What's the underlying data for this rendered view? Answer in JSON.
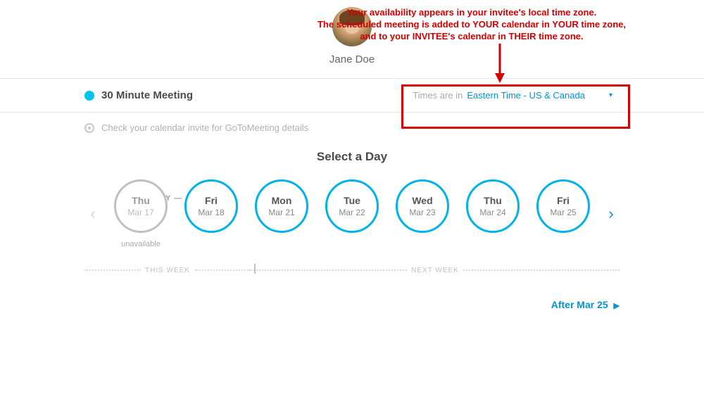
{
  "annotation": {
    "line1": "Your availability appears in your invitee's local time zone.",
    "line2": "The scheduled meeting is added to YOUR calendar in YOUR time zone,",
    "line3": "and to your INVITEE's calendar in THEIR time zone."
  },
  "host": {
    "name": "Jane Doe"
  },
  "meeting": {
    "title": "30 Minute Meeting",
    "gotomeeting_note": "Check your calendar invite for GoToMeeting details"
  },
  "timezone": {
    "label": "Times are in",
    "value": "Eastern Time - US & Canada"
  },
  "select_day_title": "Select a Day",
  "today_marker": "— TODAY —",
  "days": [
    {
      "dow": "Thu",
      "date": "Mar 17",
      "unavailable": true,
      "sub": "unavailable"
    },
    {
      "dow": "Fri",
      "date": "Mar 18",
      "unavailable": false,
      "sub": ""
    },
    {
      "dow": "Mon",
      "date": "Mar 21",
      "unavailable": false,
      "sub": ""
    },
    {
      "dow": "Tue",
      "date": "Mar 22",
      "unavailable": false,
      "sub": ""
    },
    {
      "dow": "Wed",
      "date": "Mar 23",
      "unavailable": false,
      "sub": ""
    },
    {
      "dow": "Thu",
      "date": "Mar 24",
      "unavailable": false,
      "sub": ""
    },
    {
      "dow": "Fri",
      "date": "Mar 25",
      "unavailable": false,
      "sub": ""
    }
  ],
  "week_labels": {
    "this": "THIS WEEK",
    "next": "NEXT WEEK"
  },
  "after_link": {
    "text": "After Mar 25"
  }
}
